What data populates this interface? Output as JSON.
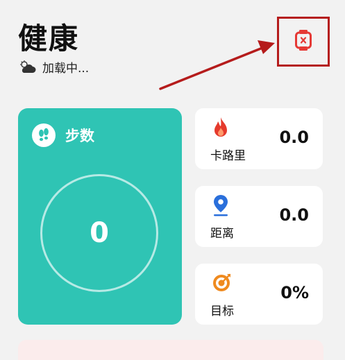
{
  "header": {
    "title": "健康"
  },
  "weather": {
    "icon": "cloud-sun-icon",
    "status": "加载中..."
  },
  "watch": {
    "icon": "watch-disconnected-icon",
    "color": "#e53935"
  },
  "steps": {
    "label": "步数",
    "value": "0",
    "icon": "footprints-icon",
    "color": "#2fc4b4"
  },
  "stats": [
    {
      "label": "卡路里",
      "value": "0.0",
      "icon": "flame-icon",
      "color": "#e53a2c"
    },
    {
      "label": "距离",
      "value": "0.0",
      "icon": "location-pin-icon",
      "color": "#2a6fdb"
    },
    {
      "label": "目标",
      "value": "0%",
      "icon": "target-icon",
      "color": "#ef8a1f"
    }
  ]
}
